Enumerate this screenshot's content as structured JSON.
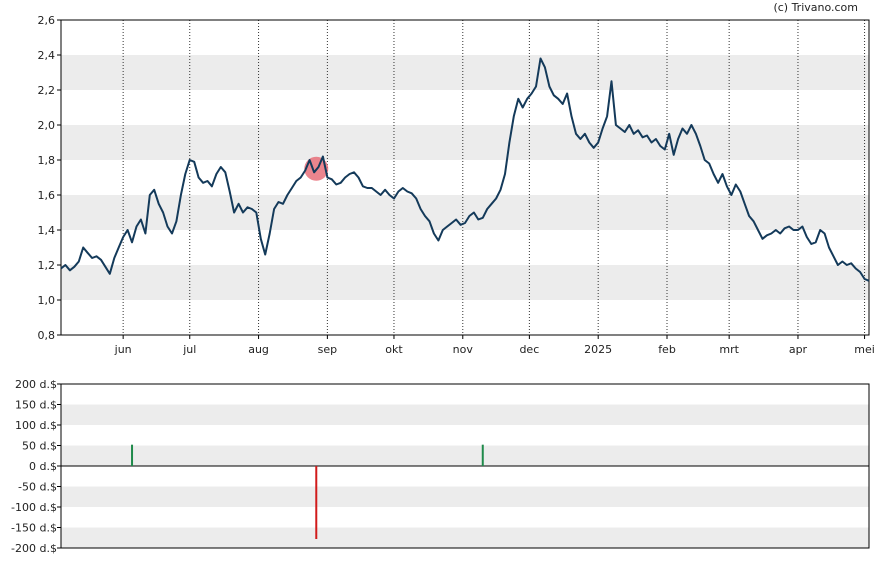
{
  "copyright": "(c) Trivano.com",
  "chart_data": [
    {
      "type": "line",
      "name": "price",
      "ylim": [
        0.8,
        2.6
      ],
      "y_ticks": [
        "0,8",
        "1,0",
        "1,2",
        "1,4",
        "1,6",
        "1,8",
        "2,0",
        "2,2",
        "2,4",
        "2,6"
      ],
      "y_tick_values": [
        0.8,
        1.0,
        1.2,
        1.4,
        1.6,
        1.8,
        2.0,
        2.2,
        2.4,
        2.6
      ],
      "x_ticks": [
        {
          "label": "jun",
          "date": "2024-06-01"
        },
        {
          "label": "jul",
          "date": "2024-07-01"
        },
        {
          "label": "aug",
          "date": "2024-08-01"
        },
        {
          "label": "sep",
          "date": "2024-09-01"
        },
        {
          "label": "okt",
          "date": "2024-10-01"
        },
        {
          "label": "nov",
          "date": "2024-11-01"
        },
        {
          "label": "dec",
          "date": "2024-12-01"
        },
        {
          "label": "2025",
          "date": "2025-01-01"
        },
        {
          "label": "feb",
          "date": "2025-02-01"
        },
        {
          "label": "mrt",
          "date": "2025-03-01"
        },
        {
          "label": "apr",
          "date": "2025-04-01"
        },
        {
          "label": "mei",
          "date": "2025-05-01"
        }
      ],
      "xlim": [
        "2024-05-04",
        "2025-05-03"
      ],
      "grid": "horizontal bands + vertical dotted month lines",
      "line_color": "#143a5a",
      "series": [
        {
          "points": [
            [
              "2024-05-04",
              1.18
            ],
            [
              "2024-05-06",
              1.2
            ],
            [
              "2024-05-08",
              1.17
            ],
            [
              "2024-05-10",
              1.19
            ],
            [
              "2024-05-12",
              1.22
            ],
            [
              "2024-05-14",
              1.3
            ],
            [
              "2024-05-16",
              1.27
            ],
            [
              "2024-05-18",
              1.24
            ],
            [
              "2024-05-20",
              1.25
            ],
            [
              "2024-05-22",
              1.23
            ],
            [
              "2024-05-24",
              1.19
            ],
            [
              "2024-05-26",
              1.15
            ],
            [
              "2024-05-28",
              1.24
            ],
            [
              "2024-05-30",
              1.3
            ],
            [
              "2024-06-01",
              1.36
            ],
            [
              "2024-06-03",
              1.4
            ],
            [
              "2024-06-05",
              1.33
            ],
            [
              "2024-06-07",
              1.42
            ],
            [
              "2024-06-09",
              1.46
            ],
            [
              "2024-06-11",
              1.38
            ],
            [
              "2024-06-13",
              1.6
            ],
            [
              "2024-06-15",
              1.63
            ],
            [
              "2024-06-17",
              1.55
            ],
            [
              "2024-06-19",
              1.5
            ],
            [
              "2024-06-21",
              1.42
            ],
            [
              "2024-06-23",
              1.38
            ],
            [
              "2024-06-25",
              1.45
            ],
            [
              "2024-06-27",
              1.6
            ],
            [
              "2024-06-29",
              1.72
            ],
            [
              "2024-07-01",
              1.8
            ],
            [
              "2024-07-03",
              1.79
            ],
            [
              "2024-07-05",
              1.7
            ],
            [
              "2024-07-07",
              1.67
            ],
            [
              "2024-07-09",
              1.68
            ],
            [
              "2024-07-11",
              1.65
            ],
            [
              "2024-07-13",
              1.72
            ],
            [
              "2024-07-15",
              1.76
            ],
            [
              "2024-07-17",
              1.73
            ],
            [
              "2024-07-19",
              1.62
            ],
            [
              "2024-07-21",
              1.5
            ],
            [
              "2024-07-23",
              1.55
            ],
            [
              "2024-07-25",
              1.5
            ],
            [
              "2024-07-27",
              1.53
            ],
            [
              "2024-07-29",
              1.52
            ],
            [
              "2024-07-31",
              1.5
            ],
            [
              "2024-08-02",
              1.35
            ],
            [
              "2024-08-04",
              1.26
            ],
            [
              "2024-08-06",
              1.38
            ],
            [
              "2024-08-08",
              1.52
            ],
            [
              "2024-08-10",
              1.56
            ],
            [
              "2024-08-12",
              1.55
            ],
            [
              "2024-08-14",
              1.6
            ],
            [
              "2024-08-16",
              1.64
            ],
            [
              "2024-08-18",
              1.68
            ],
            [
              "2024-08-20",
              1.7
            ],
            [
              "2024-08-22",
              1.74
            ],
            [
              "2024-08-24",
              1.8
            ],
            [
              "2024-08-26",
              1.73
            ],
            [
              "2024-08-28",
              1.76
            ],
            [
              "2024-08-30",
              1.82
            ],
            [
              "2024-09-01",
              1.7
            ],
            [
              "2024-09-03",
              1.69
            ],
            [
              "2024-09-05",
              1.66
            ],
            [
              "2024-09-07",
              1.67
            ],
            [
              "2024-09-09",
              1.7
            ],
            [
              "2024-09-11",
              1.72
            ],
            [
              "2024-09-13",
              1.73
            ],
            [
              "2024-09-15",
              1.7
            ],
            [
              "2024-09-17",
              1.65
            ],
            [
              "2024-09-19",
              1.64
            ],
            [
              "2024-09-21",
              1.64
            ],
            [
              "2024-09-23",
              1.62
            ],
            [
              "2024-09-25",
              1.6
            ],
            [
              "2024-09-27",
              1.63
            ],
            [
              "2024-09-29",
              1.6
            ],
            [
              "2024-10-01",
              1.58
            ],
            [
              "2024-10-03",
              1.62
            ],
            [
              "2024-10-05",
              1.64
            ],
            [
              "2024-10-07",
              1.62
            ],
            [
              "2024-10-09",
              1.61
            ],
            [
              "2024-10-11",
              1.58
            ],
            [
              "2024-10-13",
              1.52
            ],
            [
              "2024-10-15",
              1.48
            ],
            [
              "2024-10-17",
              1.45
            ],
            [
              "2024-10-19",
              1.38
            ],
            [
              "2024-10-21",
              1.34
            ],
            [
              "2024-10-23",
              1.4
            ],
            [
              "2024-10-25",
              1.42
            ],
            [
              "2024-10-27",
              1.44
            ],
            [
              "2024-10-29",
              1.46
            ],
            [
              "2024-10-31",
              1.43
            ],
            [
              "2024-11-02",
              1.44
            ],
            [
              "2024-11-04",
              1.48
            ],
            [
              "2024-11-06",
              1.5
            ],
            [
              "2024-11-08",
              1.46
            ],
            [
              "2024-11-10",
              1.47
            ],
            [
              "2024-11-12",
              1.52
            ],
            [
              "2024-11-14",
              1.55
            ],
            [
              "2024-11-16",
              1.58
            ],
            [
              "2024-11-18",
              1.63
            ],
            [
              "2024-11-20",
              1.72
            ],
            [
              "2024-11-22",
              1.9
            ],
            [
              "2024-11-24",
              2.05
            ],
            [
              "2024-11-26",
              2.15
            ],
            [
              "2024-11-28",
              2.1
            ],
            [
              "2024-11-30",
              2.15
            ],
            [
              "2024-12-02",
              2.18
            ],
            [
              "2024-12-04",
              2.22
            ],
            [
              "2024-12-06",
              2.38
            ],
            [
              "2024-12-08",
              2.33
            ],
            [
              "2024-12-10",
              2.22
            ],
            [
              "2024-12-12",
              2.17
            ],
            [
              "2024-12-14",
              2.15
            ],
            [
              "2024-12-16",
              2.12
            ],
            [
              "2024-12-18",
              2.18
            ],
            [
              "2024-12-20",
              2.05
            ],
            [
              "2024-12-22",
              1.95
            ],
            [
              "2024-12-24",
              1.92
            ],
            [
              "2024-12-26",
              1.95
            ],
            [
              "2024-12-28",
              1.9
            ],
            [
              "2024-12-30",
              1.87
            ],
            [
              "2025-01-01",
              1.9
            ],
            [
              "2025-01-03",
              1.98
            ],
            [
              "2025-01-05",
              2.05
            ],
            [
              "2025-01-07",
              2.25
            ],
            [
              "2025-01-09",
              2.0
            ],
            [
              "2025-01-11",
              1.98
            ],
            [
              "2025-01-13",
              1.96
            ],
            [
              "2025-01-15",
              2.0
            ],
            [
              "2025-01-17",
              1.95
            ],
            [
              "2025-01-19",
              1.97
            ],
            [
              "2025-01-21",
              1.93
            ],
            [
              "2025-01-23",
              1.94
            ],
            [
              "2025-01-25",
              1.9
            ],
            [
              "2025-01-27",
              1.92
            ],
            [
              "2025-01-29",
              1.88
            ],
            [
              "2025-01-31",
              1.86
            ],
            [
              "2025-02-02",
              1.95
            ],
            [
              "2025-02-04",
              1.83
            ],
            [
              "2025-02-06",
              1.92
            ],
            [
              "2025-02-08",
              1.98
            ],
            [
              "2025-02-10",
              1.95
            ],
            [
              "2025-02-12",
              2.0
            ],
            [
              "2025-02-14",
              1.95
            ],
            [
              "2025-02-16",
              1.88
            ],
            [
              "2025-02-18",
              1.8
            ],
            [
              "2025-02-20",
              1.78
            ],
            [
              "2025-02-22",
              1.72
            ],
            [
              "2025-02-24",
              1.67
            ],
            [
              "2025-02-26",
              1.72
            ],
            [
              "2025-02-28",
              1.65
            ],
            [
              "2025-03-02",
              1.6
            ],
            [
              "2025-03-04",
              1.66
            ],
            [
              "2025-03-06",
              1.62
            ],
            [
              "2025-03-08",
              1.55
            ],
            [
              "2025-03-10",
              1.48
            ],
            [
              "2025-03-12",
              1.45
            ],
            [
              "2025-03-14",
              1.4
            ],
            [
              "2025-03-16",
              1.35
            ],
            [
              "2025-03-18",
              1.37
            ],
            [
              "2025-03-20",
              1.38
            ],
            [
              "2025-03-22",
              1.4
            ],
            [
              "2025-03-24",
              1.38
            ],
            [
              "2025-03-26",
              1.41
            ],
            [
              "2025-03-28",
              1.42
            ],
            [
              "2025-03-30",
              1.4
            ],
            [
              "2025-04-01",
              1.4
            ],
            [
              "2025-04-03",
              1.42
            ],
            [
              "2025-04-05",
              1.36
            ],
            [
              "2025-04-07",
              1.32
            ],
            [
              "2025-04-09",
              1.33
            ],
            [
              "2025-04-11",
              1.4
            ],
            [
              "2025-04-13",
              1.38
            ],
            [
              "2025-04-15",
              1.3
            ],
            [
              "2025-04-17",
              1.25
            ],
            [
              "2025-04-19",
              1.2
            ],
            [
              "2025-04-21",
              1.22
            ],
            [
              "2025-04-23",
              1.2
            ],
            [
              "2025-04-25",
              1.21
            ],
            [
              "2025-04-27",
              1.18
            ],
            [
              "2025-04-29",
              1.16
            ],
            [
              "2025-05-01",
              1.12
            ],
            [
              "2025-05-03",
              1.11
            ]
          ]
        }
      ],
      "annotations": [
        {
          "type": "circle-marker",
          "date": "2024-08-27",
          "value": 1.75,
          "color": "#e8707a"
        }
      ]
    },
    {
      "type": "bar",
      "name": "insider-transactions",
      "ylim": [
        -200,
        200
      ],
      "y_ticks": [
        "200 d.$",
        "150 d.$",
        "100 d.$",
        "50 d.$",
        "0 d.$",
        "-50 d.$",
        "-100 d.$",
        "-150 d.$",
        "-200 d.$"
      ],
      "y_tick_values": [
        200,
        150,
        100,
        50,
        0,
        -50,
        -100,
        -150,
        -200
      ],
      "xlim": [
        "2024-05-04",
        "2025-05-03"
      ],
      "grid": "horizontal bands",
      "bars": [
        {
          "date": "2024-06-05",
          "value": 52,
          "color": "#1f8a4a"
        },
        {
          "date": "2024-08-27",
          "value": -178,
          "color": "#d11b1b"
        },
        {
          "date": "2024-11-10",
          "value": 52,
          "color": "#1f8a4a"
        }
      ]
    }
  ]
}
